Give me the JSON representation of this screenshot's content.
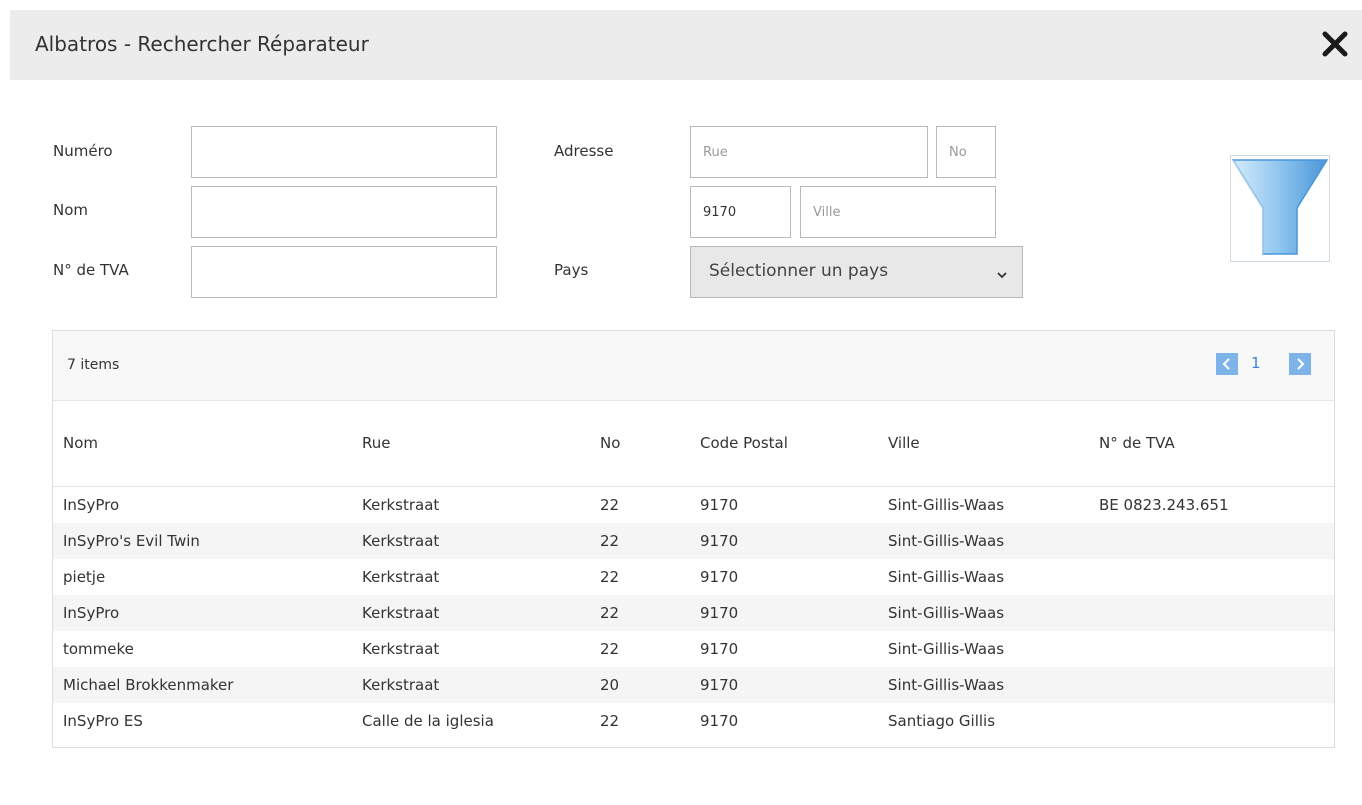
{
  "dialog": {
    "title": "Albatros - Rechercher Réparateur"
  },
  "form": {
    "numero_label": "Numéro",
    "nom_label": "Nom",
    "tva_label": "N° de TVA",
    "adresse_label": "Adresse",
    "pays_label": "Pays",
    "numero_value": "",
    "nom_value": "",
    "tva_value": "",
    "rue_placeholder": "Rue",
    "no_placeholder": "No",
    "postal_value": "9170",
    "ville_placeholder": "Ville",
    "pays_selected": "Sélectionner un pays"
  },
  "grid": {
    "count_text": "7 items",
    "page": "1",
    "columns": [
      "Nom",
      "Rue",
      "No",
      "Code Postal",
      "Ville",
      "N° de TVA"
    ],
    "rows": [
      [
        "InSyPro",
        "Kerkstraat",
        "22",
        "9170",
        "Sint-Gillis-Waas",
        "BE 0823.243.651"
      ],
      [
        "InSyPro's Evil Twin",
        "Kerkstraat",
        "22",
        "9170",
        "Sint-Gillis-Waas",
        ""
      ],
      [
        "pietje",
        "Kerkstraat",
        "22",
        "9170",
        "Sint-Gillis-Waas",
        ""
      ],
      [
        "InSyPro",
        "Kerkstraat",
        "22",
        "9170",
        "Sint-Gillis-Waas",
        ""
      ],
      [
        "tommeke",
        "Kerkstraat",
        "22",
        "9170",
        "Sint-Gillis-Waas",
        ""
      ],
      [
        "Michael Brokkenmaker",
        "Kerkstraat",
        "20",
        "9170",
        "Sint-Gillis-Waas",
        ""
      ],
      [
        "InSyPro ES",
        "Calle de la iglesia",
        "22",
        "9170",
        "Santiago Gillis",
        ""
      ]
    ]
  },
  "icons": {
    "close": "close-icon",
    "filter": "filter-funnel-icon",
    "prev": "chevron-left-icon",
    "next": "chevron-right-icon",
    "dropdown": "chevron-down-icon"
  },
  "colors": {
    "titlebar_bg": "#ececec",
    "pager_accent": "#7db3e8",
    "link_blue": "#3a86d0",
    "funnel_blue": "#8ec5ef"
  }
}
